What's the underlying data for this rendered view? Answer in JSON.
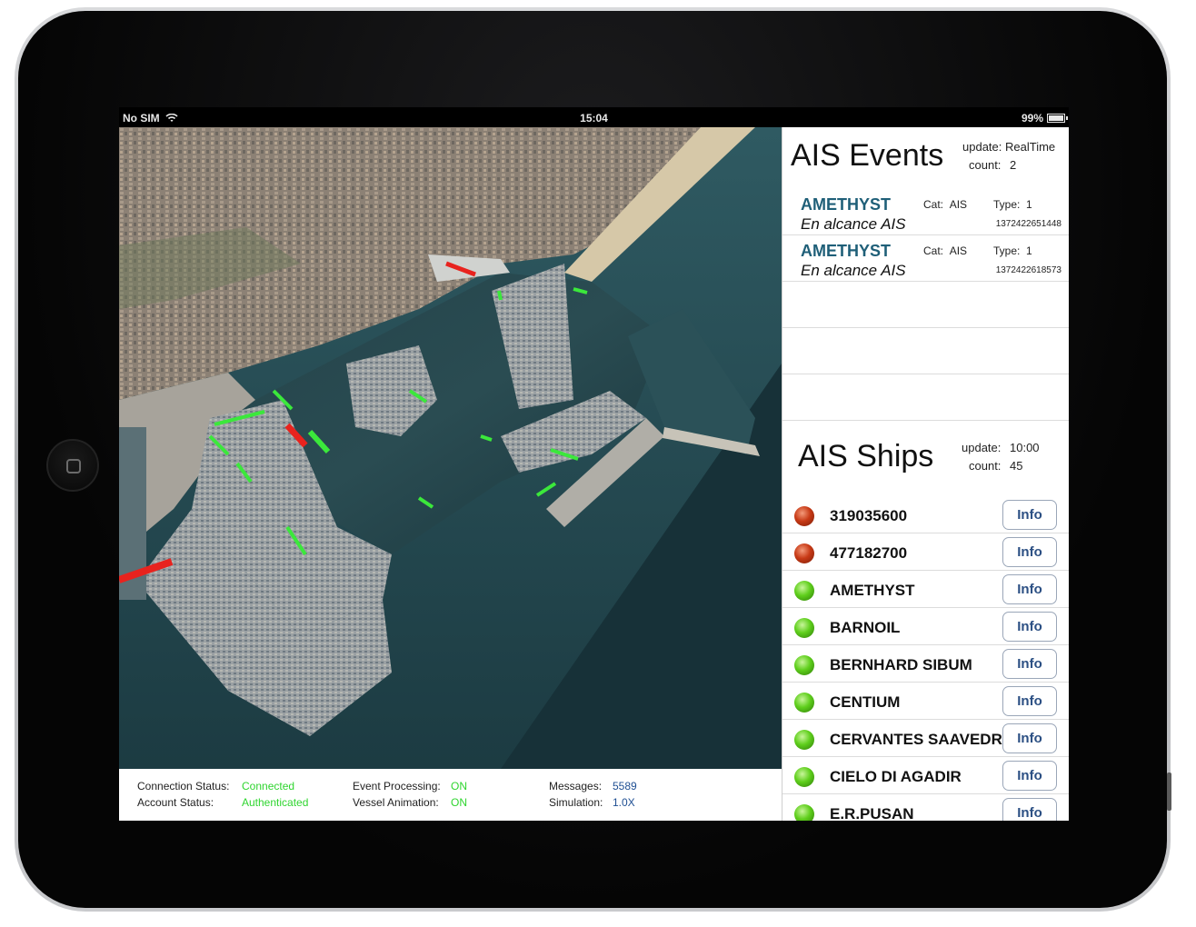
{
  "status_bar": {
    "carrier": "No SIM",
    "time": "15:04",
    "battery": "99%",
    "battery_level": 0.99
  },
  "events": {
    "title": "AIS Events",
    "update_label": "update:",
    "update_value": "RealTime",
    "count_label": "count:",
    "count_value": "2",
    "items": [
      {
        "name": "AMETHYST",
        "description": "En alcance AIS",
        "cat_label": "Cat:",
        "cat": "AIS",
        "type_label": "Type:",
        "type": "1",
        "timestamp": "1372422651448"
      },
      {
        "name": "AMETHYST",
        "description": "En alcance AIS",
        "cat_label": "Cat:",
        "cat": "AIS",
        "type_label": "Type:",
        "type": "1",
        "timestamp": "1372422618573"
      }
    ]
  },
  "ships": {
    "title": "AIS Ships",
    "update_label": "update:",
    "update_value": "10:00",
    "count_label": "count:",
    "count_value": "45",
    "info_label": "Info",
    "items": [
      {
        "name": "319035600",
        "status": "red"
      },
      {
        "name": "477182700",
        "status": "red"
      },
      {
        "name": "AMETHYST",
        "status": "green"
      },
      {
        "name": "BARNOIL",
        "status": "green"
      },
      {
        "name": "BERNHARD SIBUM",
        "status": "green"
      },
      {
        "name": "CENTIUM",
        "status": "green"
      },
      {
        "name": "CERVANTES SAAVEDRA",
        "status": "green"
      },
      {
        "name": "CIELO DI AGADIR",
        "status": "green"
      },
      {
        "name": "E.R.PUSAN",
        "status": "green"
      }
    ]
  },
  "bottom_status": {
    "connection_label": "Connection Status:",
    "connection_value": "Connected",
    "account_label": "Account Status:",
    "account_value": "Authenticated",
    "event_processing_label": "Event Processing:",
    "event_processing_value": "ON",
    "vessel_animation_label": "Vessel Animation:",
    "vessel_animation_value": "ON",
    "messages_label": "Messages:",
    "messages_value": "5589",
    "simulation_label": "Simulation:",
    "simulation_value": "1.0X"
  },
  "colors": {
    "status_green": "#2fd52f",
    "status_blue": "#1f4f93",
    "event_name": "#1f5f78",
    "ship_moving": "#3be83b",
    "ship_alert": "#e8231e"
  }
}
